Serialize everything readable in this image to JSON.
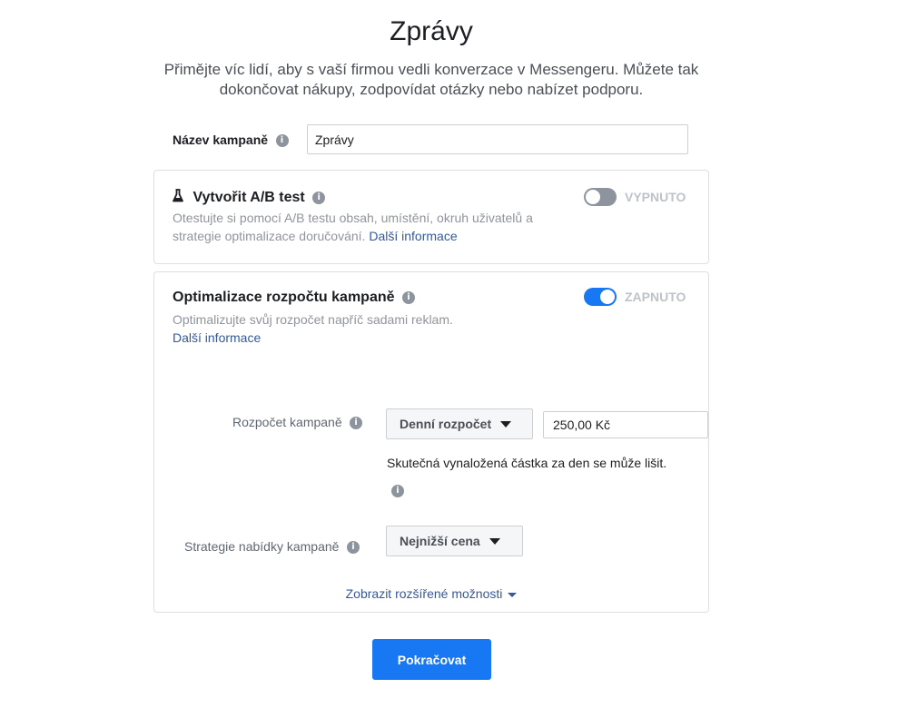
{
  "header": {
    "title": "Zprávy",
    "subtitle_line1": "Přimějte víc lidí, aby s vaší firmou vedli konverzace v Messengeru. Můžete tak",
    "subtitle_line2": "dokončovat nákupy, zodpovídat otázky nebo nabízet podporu."
  },
  "campaign_name": {
    "label": "Název kampaně",
    "value": "Zprávy"
  },
  "ab_test": {
    "title": "Vytvořit A/B test",
    "desc_line1": "Otestujte si pomocí A/B testu obsah, umístění, okruh uživatelů a",
    "desc_line2": "strategie optimalizace doručování.",
    "link": "Další informace",
    "toggle_label": "VYPNUTO",
    "toggle_on": false
  },
  "budget_opt": {
    "title": "Optimalizace rozpočtu kampaně",
    "desc": "Optimalizujte svůj rozpočet napříč sadami reklam.",
    "link": "Další informace",
    "toggle_label": "ZAPNUTO",
    "toggle_on": true,
    "budget_label": "Rozpočet kampaně",
    "budget_type": "Denní rozpočet",
    "budget_value": "250,00 Kč",
    "budget_note": "Skutečná vynaložená částka za den se může lišit.",
    "bid_label": "Strategie nabídky kampaně",
    "bid_value": "Nejnižší cena",
    "advanced_link": "Zobrazit rozšířené možnosti"
  },
  "footer": {
    "continue_label": "Pokračovat"
  },
  "colors": {
    "primary": "#1877f2",
    "link": "#365899",
    "toggle_off": "#8d949e"
  }
}
